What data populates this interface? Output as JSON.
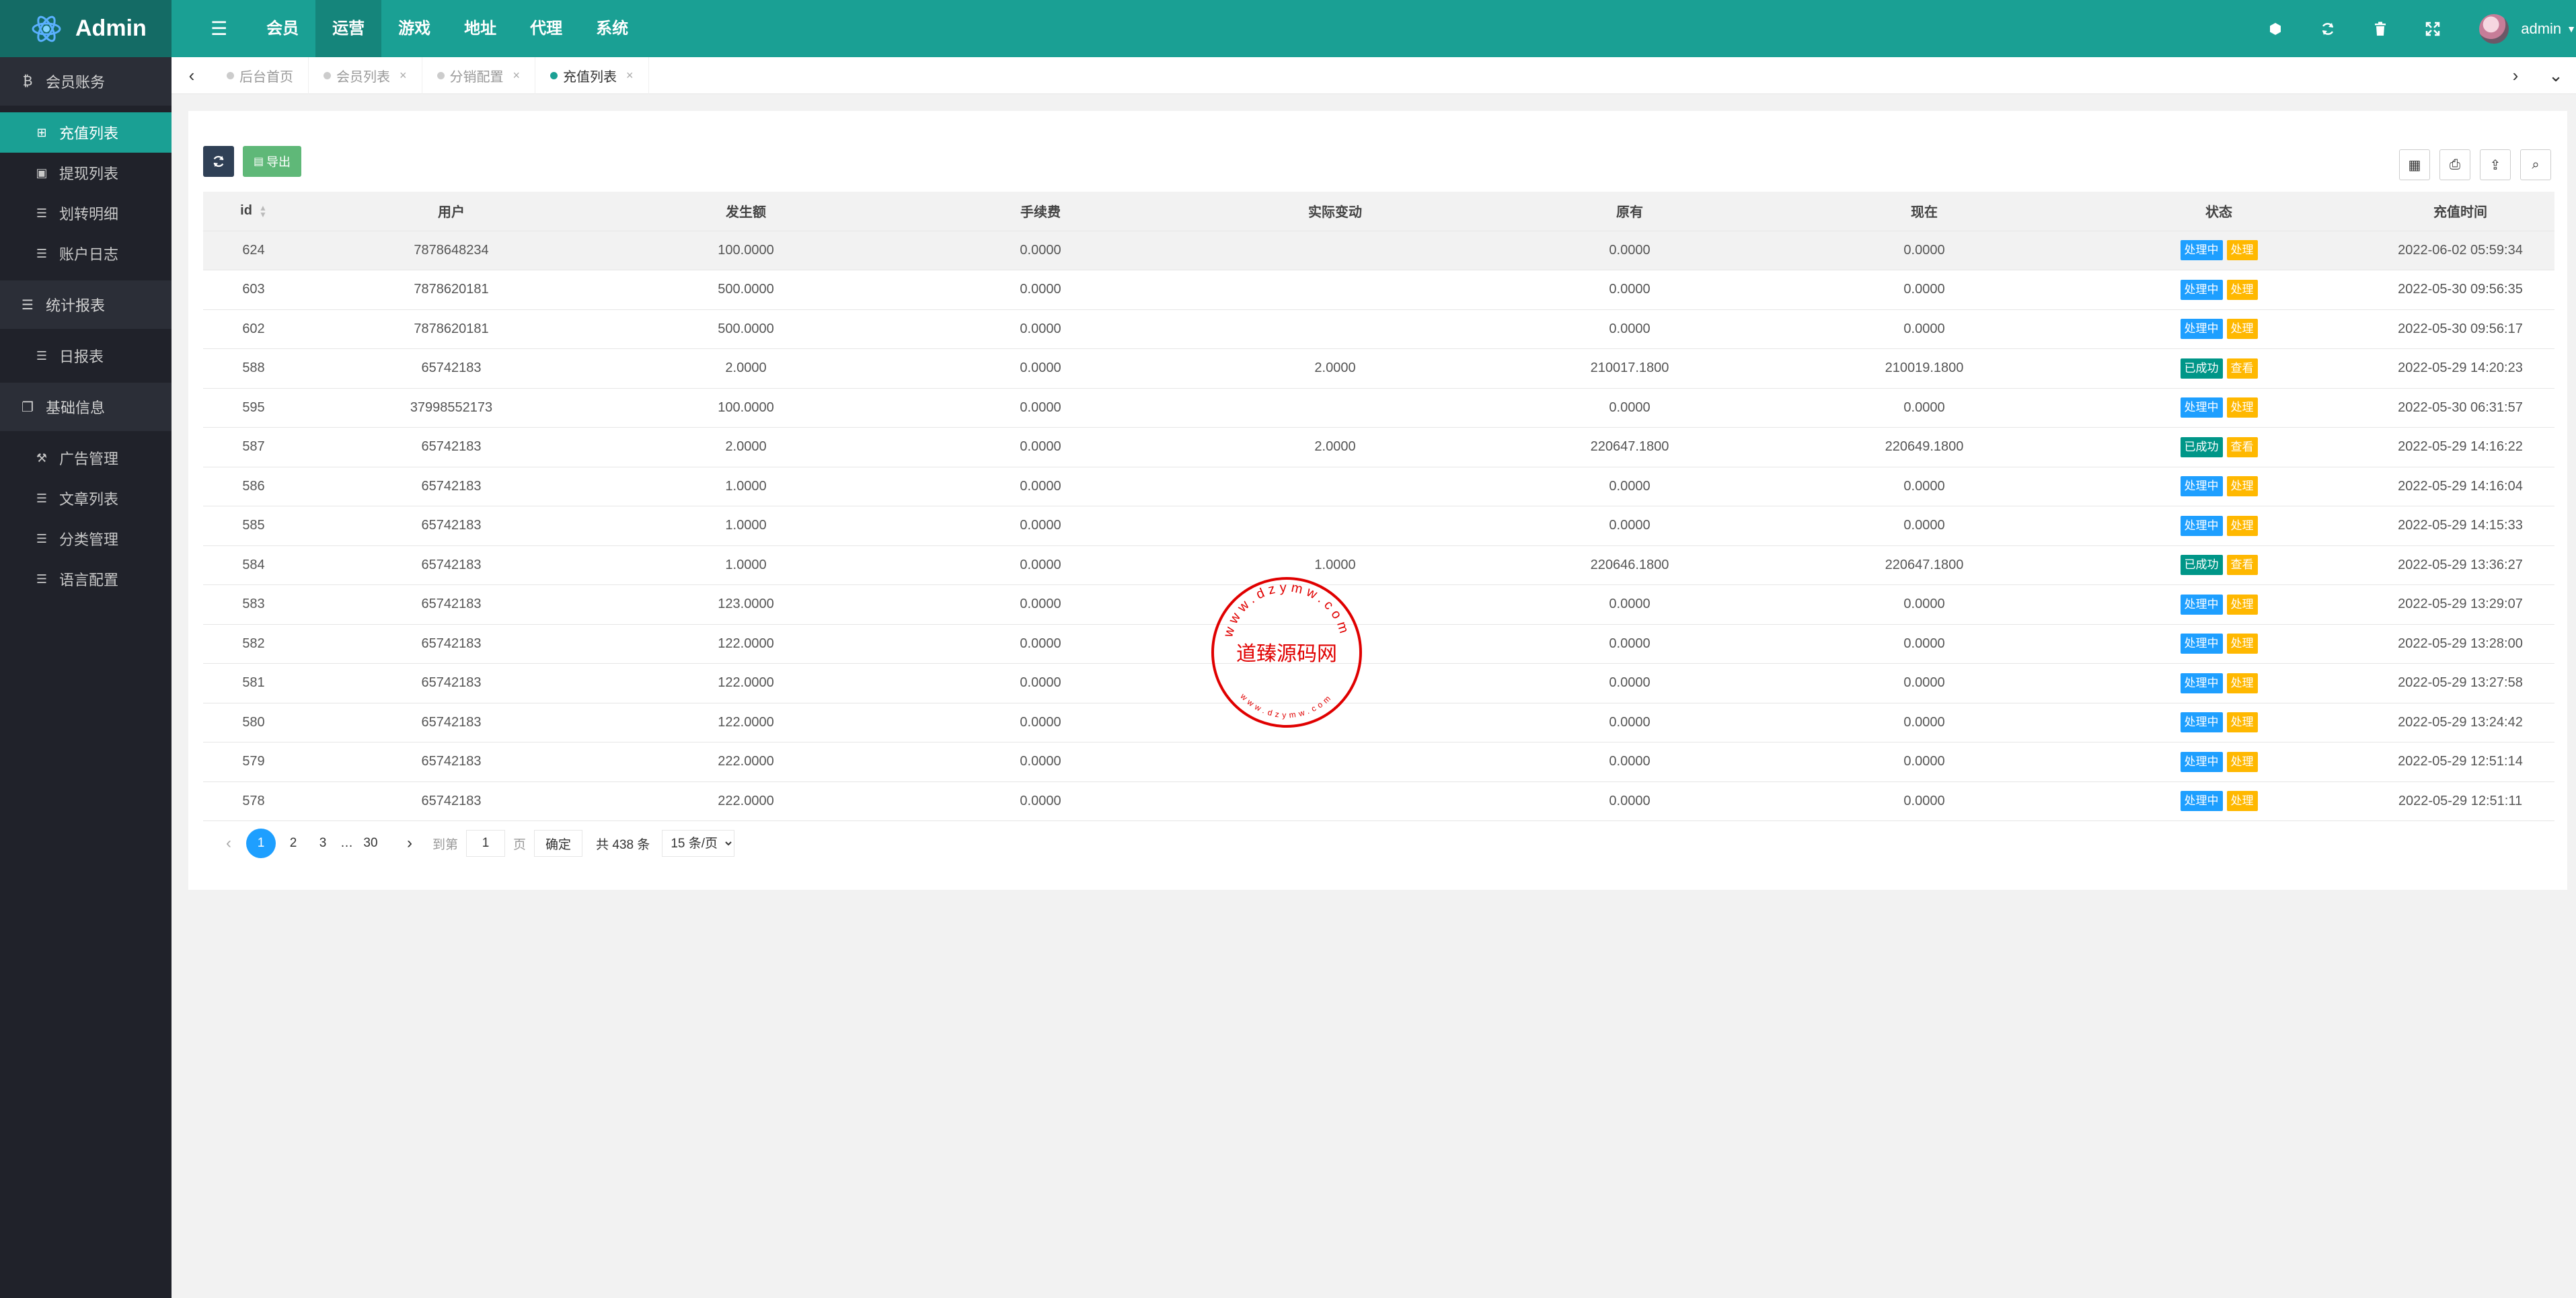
{
  "app": {
    "title": "Admin"
  },
  "header": {
    "nav": [
      {
        "label": "☰",
        "icon": true
      },
      {
        "label": "会员"
      },
      {
        "label": "运营",
        "active": true
      },
      {
        "label": "游戏"
      },
      {
        "label": "地址"
      },
      {
        "label": "代理"
      },
      {
        "label": "系统"
      }
    ],
    "tools": [
      "clear-cache-icon",
      "refresh-icon",
      "delete-icon",
      "fullscreen-icon"
    ],
    "user": {
      "name": "admin"
    }
  },
  "sidebar": {
    "groups": [
      {
        "label": "会员账务",
        "icon": "bitcoin-icon",
        "items": [
          {
            "label": "充值列表",
            "active": true
          },
          {
            "label": "提现列表"
          },
          {
            "label": "划转明细"
          },
          {
            "label": "账户日志"
          }
        ]
      },
      {
        "label": "统计报表",
        "icon": "list-icon",
        "items": [
          {
            "label": "日报表"
          }
        ]
      },
      {
        "label": "基础信息",
        "icon": "copy-icon",
        "items": [
          {
            "label": "广告管理"
          },
          {
            "label": "文章列表"
          },
          {
            "label": "分类管理"
          },
          {
            "label": "语言配置"
          }
        ]
      }
    ]
  },
  "tabs": [
    {
      "label": "后台首页",
      "closable": false
    },
    {
      "label": "会员列表",
      "closable": true
    },
    {
      "label": "分销配置",
      "closable": true
    },
    {
      "label": "充值列表",
      "closable": true,
      "active": true
    }
  ],
  "toolbar": {
    "export_label": "导出"
  },
  "table": {
    "columns": [
      "id",
      "用户",
      "发生额",
      "手续费",
      "实际变动",
      "原有",
      "现在",
      "状态",
      "充值时间"
    ],
    "rows": [
      {
        "id": "624",
        "user": "7878648234",
        "amount": "100.0000",
        "fee": "0.0000",
        "actual": "",
        "before": "0.0000",
        "after": "0.0000",
        "status": "处理中",
        "action": "处理",
        "time": "2022-06-02 05:59:34"
      },
      {
        "id": "603",
        "user": "7878620181",
        "amount": "500.0000",
        "fee": "0.0000",
        "actual": "",
        "before": "0.0000",
        "after": "0.0000",
        "status": "处理中",
        "action": "处理",
        "time": "2022-05-30 09:56:35"
      },
      {
        "id": "602",
        "user": "7878620181",
        "amount": "500.0000",
        "fee": "0.0000",
        "actual": "",
        "before": "0.0000",
        "after": "0.0000",
        "status": "处理中",
        "action": "处理",
        "time": "2022-05-30 09:56:17"
      },
      {
        "id": "588",
        "user": "65742183",
        "amount": "2.0000",
        "fee": "0.0000",
        "actual": "2.0000",
        "before": "210017.1800",
        "after": "210019.1800",
        "status": "已成功",
        "action": "查看",
        "time": "2022-05-29 14:20:23"
      },
      {
        "id": "595",
        "user": "37998552173",
        "amount": "100.0000",
        "fee": "0.0000",
        "actual": "",
        "before": "0.0000",
        "after": "0.0000",
        "status": "处理中",
        "action": "处理",
        "time": "2022-05-30 06:31:57"
      },
      {
        "id": "587",
        "user": "65742183",
        "amount": "2.0000",
        "fee": "0.0000",
        "actual": "2.0000",
        "before": "220647.1800",
        "after": "220649.1800",
        "status": "已成功",
        "action": "查看",
        "time": "2022-05-29 14:16:22"
      },
      {
        "id": "586",
        "user": "65742183",
        "amount": "1.0000",
        "fee": "0.0000",
        "actual": "",
        "before": "0.0000",
        "after": "0.0000",
        "status": "处理中",
        "action": "处理",
        "time": "2022-05-29 14:16:04"
      },
      {
        "id": "585",
        "user": "65742183",
        "amount": "1.0000",
        "fee": "0.0000",
        "actual": "",
        "before": "0.0000",
        "after": "0.0000",
        "status": "处理中",
        "action": "处理",
        "time": "2022-05-29 14:15:33"
      },
      {
        "id": "584",
        "user": "65742183",
        "amount": "1.0000",
        "fee": "0.0000",
        "actual": "1.0000",
        "before": "220646.1800",
        "after": "220647.1800",
        "status": "已成功",
        "action": "查看",
        "time": "2022-05-29 13:36:27"
      },
      {
        "id": "583",
        "user": "65742183",
        "amount": "123.0000",
        "fee": "0.0000",
        "actual": "",
        "before": "0.0000",
        "after": "0.0000",
        "status": "处理中",
        "action": "处理",
        "time": "2022-05-29 13:29:07"
      },
      {
        "id": "582",
        "user": "65742183",
        "amount": "122.0000",
        "fee": "0.0000",
        "actual": "",
        "before": "0.0000",
        "after": "0.0000",
        "status": "处理中",
        "action": "处理",
        "time": "2022-05-29 13:28:00"
      },
      {
        "id": "581",
        "user": "65742183",
        "amount": "122.0000",
        "fee": "0.0000",
        "actual": "",
        "before": "0.0000",
        "after": "0.0000",
        "status": "处理中",
        "action": "处理",
        "time": "2022-05-29 13:27:58"
      },
      {
        "id": "580",
        "user": "65742183",
        "amount": "122.0000",
        "fee": "0.0000",
        "actual": "",
        "before": "0.0000",
        "after": "0.0000",
        "status": "处理中",
        "action": "处理",
        "time": "2022-05-29 13:24:42"
      },
      {
        "id": "579",
        "user": "65742183",
        "amount": "222.0000",
        "fee": "0.0000",
        "actual": "",
        "before": "0.0000",
        "after": "0.0000",
        "status": "处理中",
        "action": "处理",
        "time": "2022-05-29 12:51:14"
      },
      {
        "id": "578",
        "user": "65742183",
        "amount": "222.0000",
        "fee": "0.0000",
        "actual": "",
        "before": "0.0000",
        "after": "0.0000",
        "status": "处理中",
        "action": "处理",
        "time": "2022-05-29 12:51:11"
      }
    ]
  },
  "pagination": {
    "pages": [
      "1",
      "2",
      "3"
    ],
    "current": "1",
    "ellipsis": "…",
    "last_page": "30",
    "goto_label": "到第",
    "goto_value": "1",
    "page_unit": "页",
    "confirm_label": "确定",
    "total_text": "共 438 条",
    "page_size": "15 条/页"
  },
  "watermark": {
    "main_text": "道臻源码网",
    "ring_text": "www.dzymw.com"
  },
  "colors": {
    "header": "#1aa094",
    "logo_bg": "#146b65",
    "sidebar": "#20222a",
    "active": "#1aa094",
    "processing": "#1e9fff",
    "success": "#009688",
    "action": "#ffb800"
  }
}
